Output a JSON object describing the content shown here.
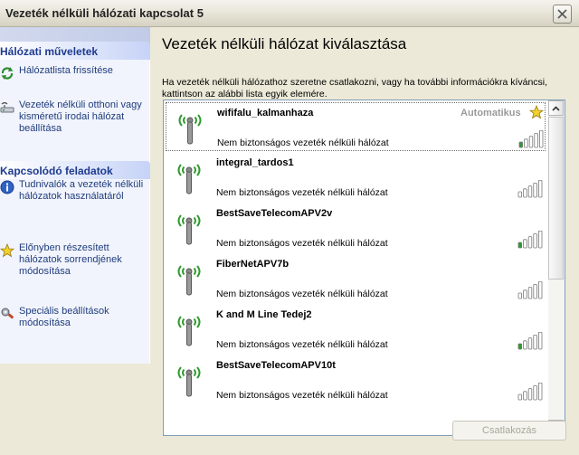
{
  "window": {
    "title": "Vezeték nélküli hálózati kapcsolat 5"
  },
  "sidebar": {
    "groups": [
      {
        "title": "Hálózati műveletek",
        "tasks": [
          {
            "label": "Hálózatlista frissítése",
            "icon": "refresh-icon"
          },
          {
            "label": "Vezeték nélküli otthoni vagy kisméretű irodai hálózat beállítása",
            "icon": "wireless-setup-icon"
          }
        ]
      },
      {
        "title": "Kapcsolódó feladatok",
        "tasks": [
          {
            "label": "Tudnivalók a vezeték nélküli hálózatok használatáról",
            "icon": "info-icon"
          },
          {
            "label": "Előnyben részesített hálózatok sorrendjének módosítása",
            "icon": "star-icon"
          },
          {
            "label": "Speciális beállítások módosítása",
            "icon": "settings-icon"
          }
        ]
      }
    ]
  },
  "main": {
    "heading": "Vezeték nélküli hálózat kiválasztása",
    "description": "Ha vezeték nélküli hálózathoz szeretne csatlakozni, vagy ha további információkra kíváncsi, kattintson az alábbi lista egyik elemére.",
    "networks": [
      {
        "name": "wififalu_kalmanhaza",
        "status": "Nem biztonságos vezeték nélküli hálózat",
        "badge": "Automatikus",
        "signal_bars": 1,
        "selected": true
      },
      {
        "name": "integral_tardos1",
        "status": "Nem biztonságos vezeték nélküli hálózat",
        "signal_bars": 0
      },
      {
        "name": "BestSaveTelecomAPV2v",
        "status": "Nem biztonságos vezeték nélküli hálózat",
        "signal_bars": 1
      },
      {
        "name": "FiberNetAPV7b",
        "status": "Nem biztonságos vezeték nélküli hálózat",
        "signal_bars": 0
      },
      {
        "name": "K and M Line Tedej2",
        "status": "Nem biztonságos vezeték nélküli hálózat",
        "signal_bars": 1
      },
      {
        "name": "BestSaveTelecomAPV10t",
        "status": "Nem biztonságos vezeték nélküli hálózat",
        "signal_bars": 0
      }
    ],
    "connect_label": "Csatlakozás"
  },
  "colors": {
    "signal_on": "#2E9A2E",
    "signal_off": "#FFFFFF",
    "task_link": "#1F3C7C",
    "group_title": "#1D3A8F"
  }
}
